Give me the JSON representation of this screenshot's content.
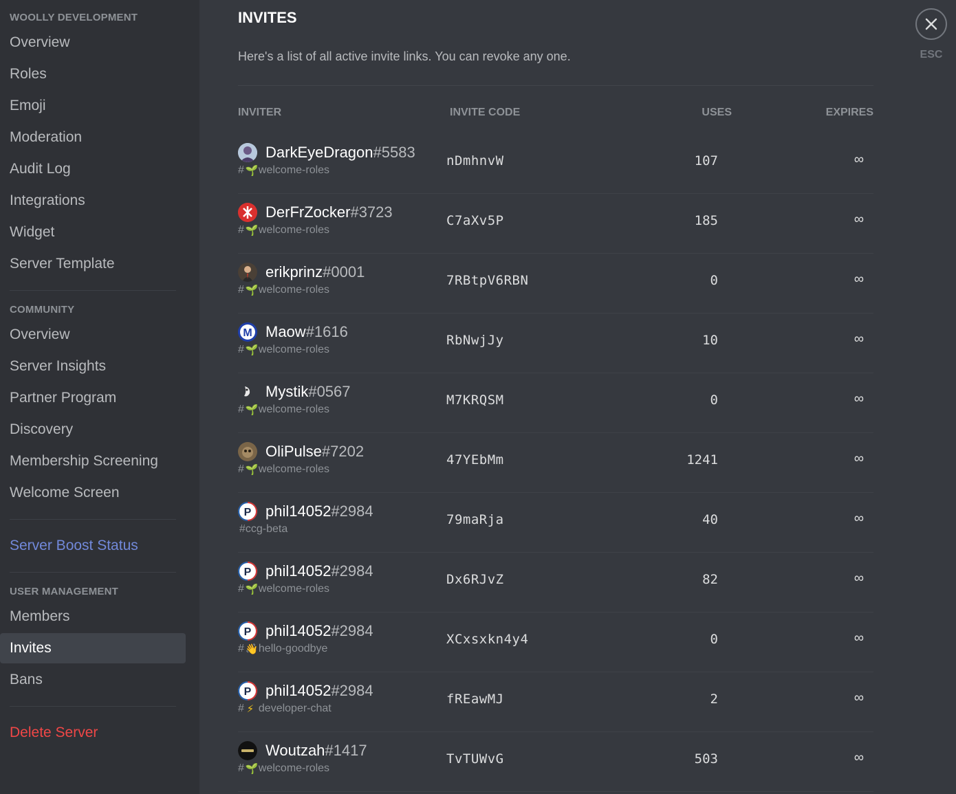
{
  "sidebar": {
    "server_header": "WOOLLY DEVELOPMENT",
    "server_items": [
      "Overview",
      "Roles",
      "Emoji",
      "Moderation",
      "Audit Log",
      "Integrations",
      "Widget",
      "Server Template"
    ],
    "community_header": "COMMUNITY",
    "community_items": [
      "Overview",
      "Server Insights",
      "Partner Program",
      "Discovery",
      "Membership Screening",
      "Welcome Screen"
    ],
    "boost_label": "Server Boost Status",
    "user_mgmt_header": "USER MANAGEMENT",
    "user_mgmt_items": [
      "Members",
      "Invites",
      "Bans"
    ],
    "selected_item": "Invites",
    "delete_label": "Delete Server"
  },
  "page": {
    "title": "INVITES",
    "subtitle": "Here's a list of all active invite links. You can revoke any one."
  },
  "table": {
    "columns": {
      "inviter": "INVITER",
      "code": "INVITE CODE",
      "uses": "USES",
      "expires": "EXPIRES"
    },
    "rows": [
      {
        "username": "DarkEyeDragon",
        "discriminator": "#5583",
        "channel_prefix": "#",
        "channel": "welcome-roles",
        "channel_icon": "seedling-icon",
        "code": "nDmhnvW",
        "uses": "107",
        "expires": "∞"
      },
      {
        "username": "DerFrZocker",
        "discriminator": "#3723",
        "channel_prefix": "#",
        "channel": "welcome-roles",
        "channel_icon": "seedling-icon",
        "code": "C7aXv5P",
        "uses": "185",
        "expires": "∞"
      },
      {
        "username": "erikprinz",
        "discriminator": "#0001",
        "channel_prefix": "#",
        "channel": "welcome-roles",
        "channel_icon": "seedling-icon",
        "code": "7RBtpV6RBN",
        "uses": "0",
        "expires": "∞"
      },
      {
        "username": "Maow",
        "discriminator": "#1616",
        "channel_prefix": "#",
        "channel": "welcome-roles",
        "channel_icon": "seedling-icon",
        "code": "RbNwjJy",
        "uses": "10",
        "expires": "∞"
      },
      {
        "username": "Mystik",
        "discriminator": "#0567",
        "channel_prefix": "#",
        "channel": "welcome-roles",
        "channel_icon": "seedling-icon",
        "code": "M7KRQSM",
        "uses": "0",
        "expires": "∞"
      },
      {
        "username": "OliPulse",
        "discriminator": "#7202",
        "channel_prefix": "#",
        "channel": "welcome-roles",
        "channel_icon": "seedling-icon",
        "code": "47YEbMm",
        "uses": "1241",
        "expires": "∞"
      },
      {
        "username": "phil14052",
        "discriminator": "#2984",
        "channel_prefix": "",
        "channel": "#ccg-beta",
        "channel_icon": "",
        "code": "79maRja",
        "uses": "40",
        "expires": "∞"
      },
      {
        "username": "phil14052",
        "discriminator": "#2984",
        "channel_prefix": "#",
        "channel": "welcome-roles",
        "channel_icon": "seedling-icon",
        "code": "Dx6RJvZ",
        "uses": "82",
        "expires": "∞"
      },
      {
        "username": "phil14052",
        "discriminator": "#2984",
        "channel_prefix": "#",
        "channel": "hello-goodbye",
        "channel_icon": "wave-icon",
        "code": "XCxsxkn4y4",
        "uses": "0",
        "expires": "∞"
      },
      {
        "username": "phil14052",
        "discriminator": "#2984",
        "channel_prefix": "#",
        "channel": "developer-chat",
        "channel_icon": "lightning-icon",
        "code": "fREawMJ",
        "uses": "2",
        "expires": "∞"
      },
      {
        "username": "Woutzah",
        "discriminator": "#1417",
        "channel_prefix": "#",
        "channel": "welcome-roles",
        "channel_icon": "seedling-icon",
        "code": "TvTUWvG",
        "uses": "503",
        "expires": "∞"
      }
    ]
  },
  "close": {
    "label": "ESC",
    "icon": "close-icon"
  },
  "colors": {
    "background": "#36393f",
    "sidebar": "#2f3136",
    "boost_link": "#7289da",
    "danger": "#f04747",
    "selected_bg": "#40444b"
  }
}
